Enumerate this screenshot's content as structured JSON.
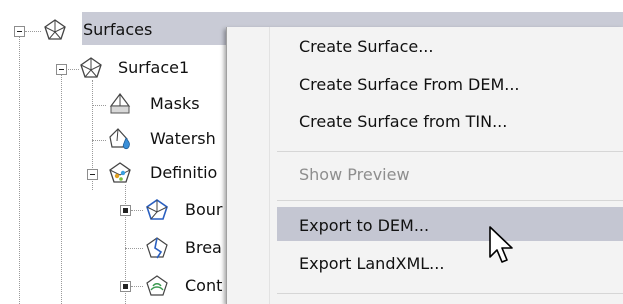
{
  "tree": {
    "root": {
      "label": "Surfaces",
      "icon": "surfaces-icon",
      "selected": true,
      "expanded": true
    },
    "items": [
      {
        "label": "Surface1",
        "icon": "surface-icon",
        "expanded": true
      },
      {
        "label": "Masks",
        "icon": "masks-icon"
      },
      {
        "label": "Watersh",
        "icon": "watersheds-icon"
      },
      {
        "label": "Definitio",
        "icon": "definition-icon",
        "expanded": true
      },
      {
        "label": "Bour",
        "icon": "boundaries-icon",
        "has_bullet": true
      },
      {
        "label": "Brea",
        "icon": "breaklines-icon"
      },
      {
        "label": "Cont",
        "icon": "contours-icon",
        "has_bullet": true
      }
    ]
  },
  "context_menu": {
    "items": [
      {
        "label": "Create Surface..."
      },
      {
        "label": "Create Surface From DEM..."
      },
      {
        "label": "Create Surface from TIN..."
      },
      {
        "label": "Show Preview",
        "disabled": true
      },
      {
        "label": "Export to DEM...",
        "highlighted": true
      },
      {
        "label": "Export LandXML..."
      }
    ]
  },
  "colors": {
    "selection": "#c9cbd6",
    "menu_background": "#f3f3f3",
    "menu_highlight": "#c4c6d2",
    "disabled_text": "#8e8e8e"
  },
  "cursor": {
    "icon": "arrow-cursor-icon"
  }
}
